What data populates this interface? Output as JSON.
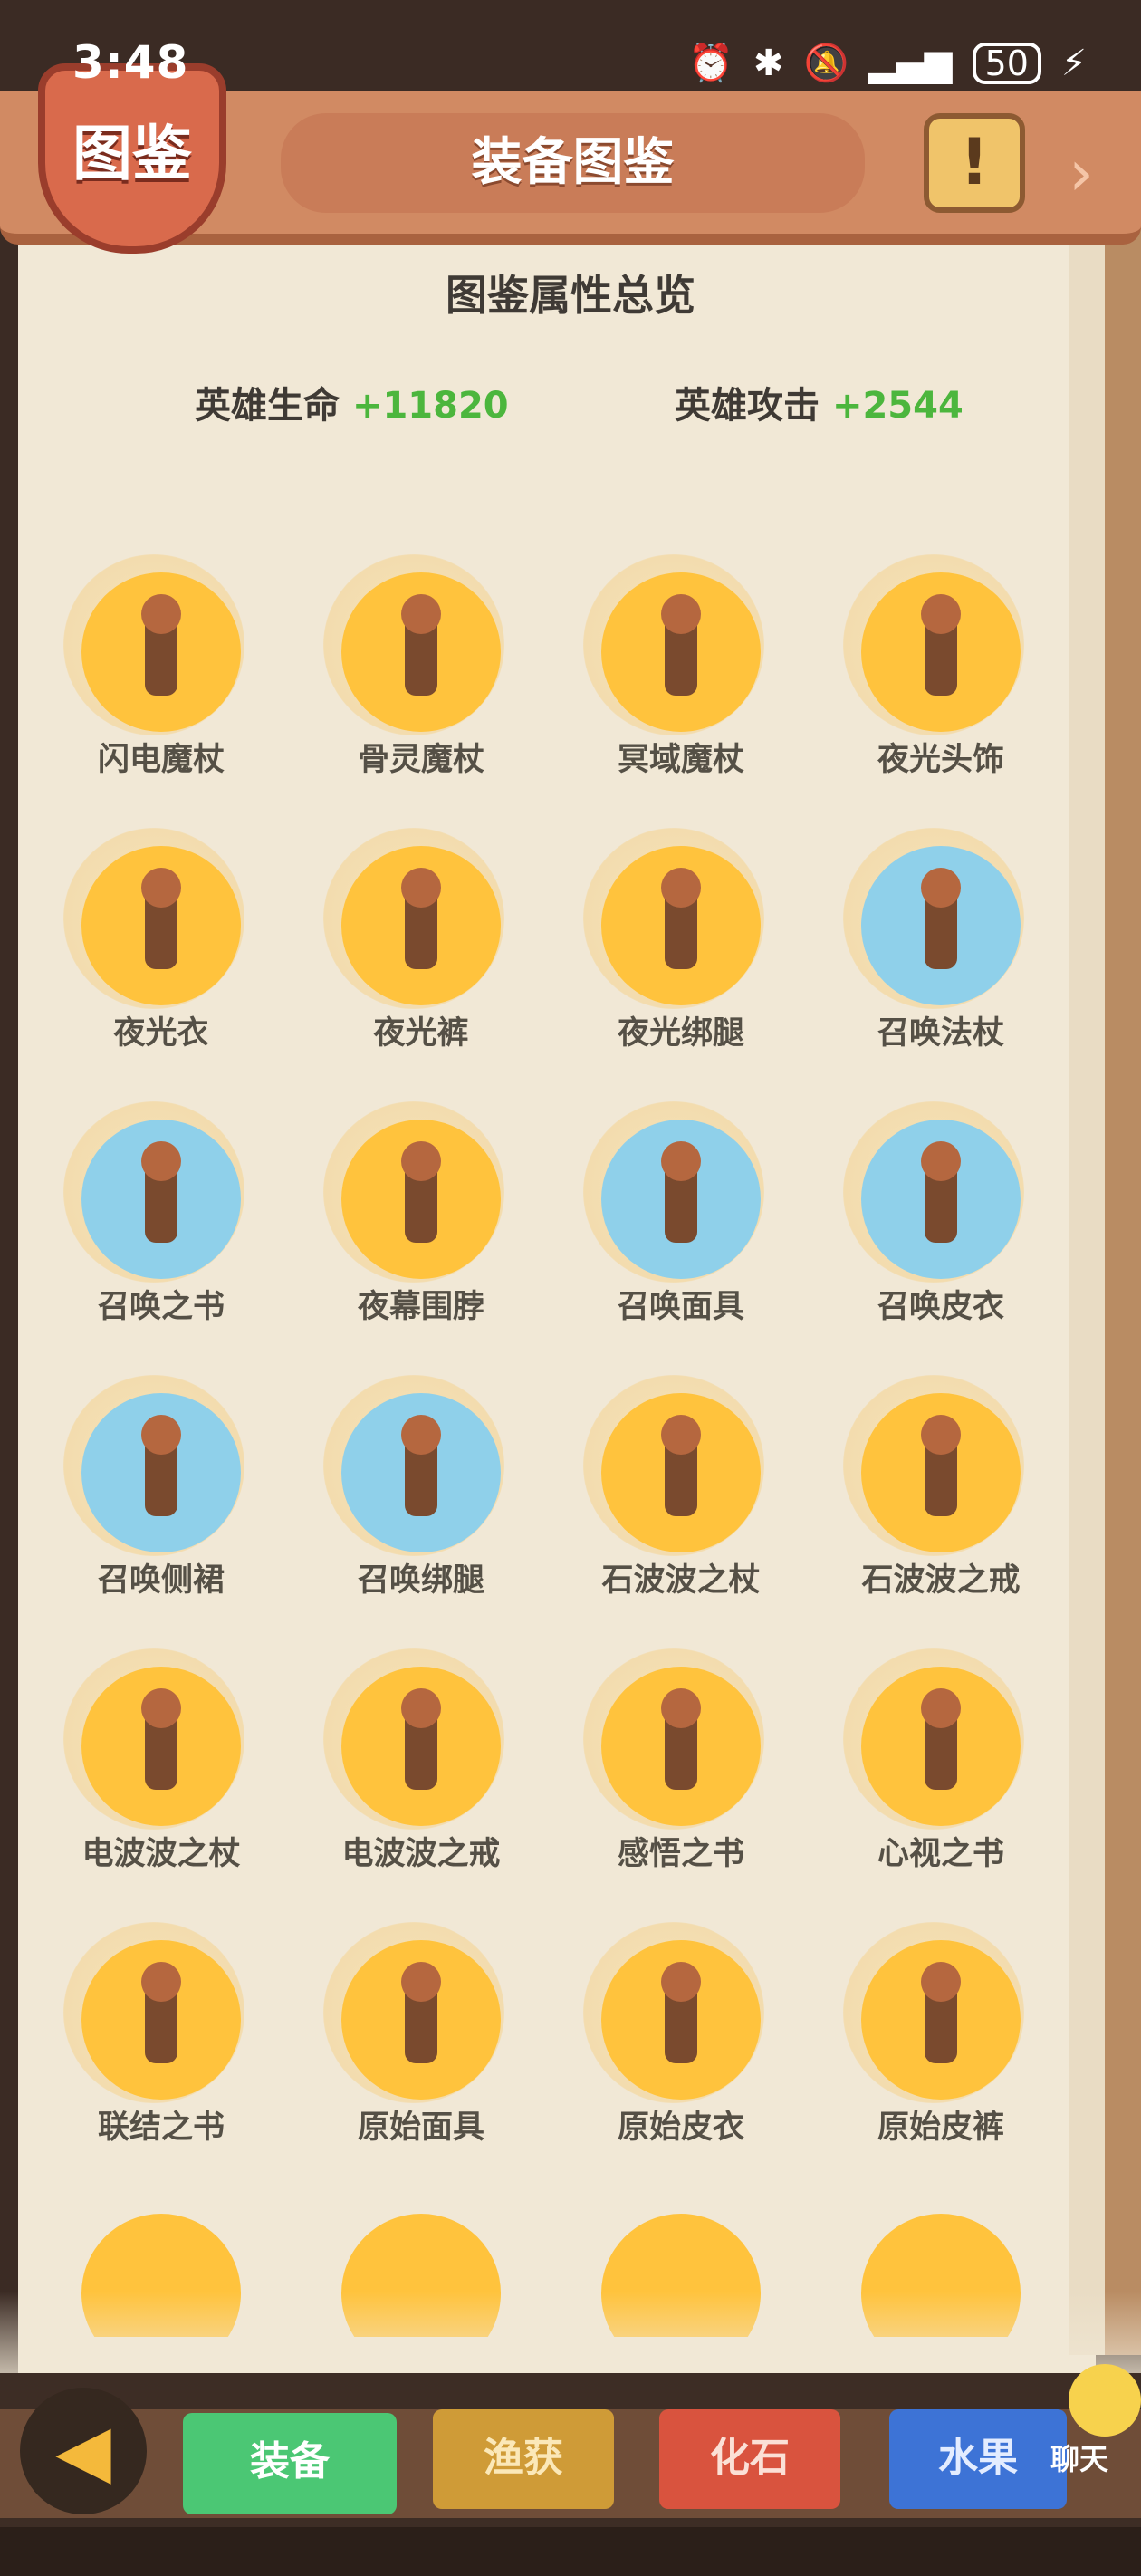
{
  "status_bar": {
    "time": "3:48",
    "battery": "50",
    "icons": [
      "alarm-icon",
      "bluetooth-icon",
      "vibrate-icon",
      "mute-icon",
      "wifi-icon",
      "signal-icon",
      "charging-icon"
    ]
  },
  "header": {
    "badge": "图鉴",
    "title": "装备图鉴"
  },
  "overview": {
    "title": "图鉴属性总览",
    "hp_label": "英雄生命",
    "hp_value": "+11820",
    "atk_label": "英雄攻击",
    "atk_value": "+2544"
  },
  "items": [
    {
      "name": "闪电魔杖",
      "bg": "gold"
    },
    {
      "name": "骨灵魔杖",
      "bg": "gold"
    },
    {
      "name": "冥域魔杖",
      "bg": "gold"
    },
    {
      "name": "夜光头饰",
      "bg": "gold"
    },
    {
      "name": "夜光衣",
      "bg": "gold"
    },
    {
      "name": "夜光裤",
      "bg": "gold"
    },
    {
      "name": "夜光绑腿",
      "bg": "gold"
    },
    {
      "name": "召唤法杖",
      "bg": "blue"
    },
    {
      "name": "召唤之书",
      "bg": "blue"
    },
    {
      "name": "夜幕围脖",
      "bg": "gold"
    },
    {
      "name": "召唤面具",
      "bg": "blue"
    },
    {
      "name": "召唤皮衣",
      "bg": "blue"
    },
    {
      "name": "召唤侧裙",
      "bg": "blue"
    },
    {
      "name": "召唤绑腿",
      "bg": "blue"
    },
    {
      "name": "石波波之杖",
      "bg": "gold"
    },
    {
      "name": "石波波之戒",
      "bg": "gold"
    },
    {
      "name": "电波波之杖",
      "bg": "gold"
    },
    {
      "name": "电波波之戒",
      "bg": "gold"
    },
    {
      "name": "感悟之书",
      "bg": "gold"
    },
    {
      "name": "心视之书",
      "bg": "gold"
    },
    {
      "name": "联结之书",
      "bg": "gold"
    },
    {
      "name": "原始面具",
      "bg": "gold"
    },
    {
      "name": "原始皮衣",
      "bg": "gold"
    },
    {
      "name": "原始皮裤",
      "bg": "gold"
    }
  ],
  "bottom_tabs": {
    "equip": "装备",
    "fish": "渔获",
    "fossil": "化石",
    "fruit": "水果"
  },
  "chat_label": "聊天",
  "colors": {
    "gold": "#ffc33d",
    "blue": "#8fd0ea",
    "bonus_green": "#4cb63d",
    "tab_active": "#4bc774"
  }
}
